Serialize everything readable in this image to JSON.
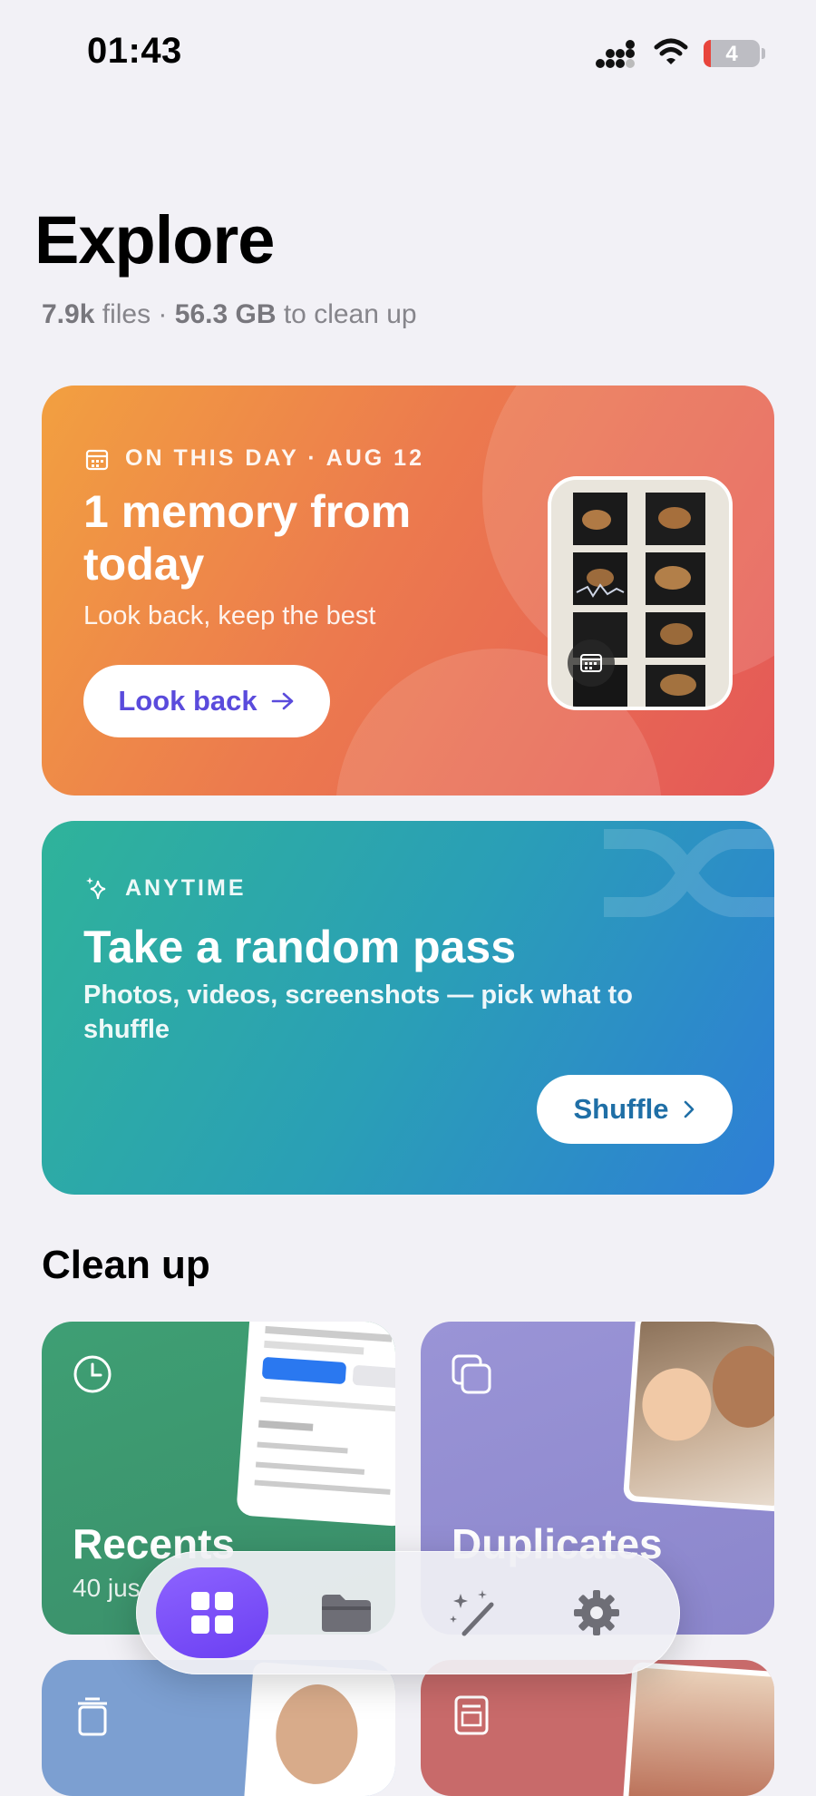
{
  "status_bar": {
    "time": "01:43",
    "battery": "4"
  },
  "header": {
    "title": "Explore",
    "files_count": "7.9k",
    "files_word": "files ·",
    "size": "56.3 GB",
    "size_suffix": "to clean up"
  },
  "memory_card": {
    "eyebrow": "ON THIS DAY · AUG 12",
    "title_line1": "1 memory from",
    "title_line2": "today",
    "subtitle": "Look back, keep the best",
    "button_label": "Look back",
    "button_color": "#5a4bdc",
    "icon": "calendar-icon"
  },
  "random_card": {
    "eyebrow": "ANYTIME",
    "title": "Take a random pass",
    "subtitle_line1": "Photos, videos, screenshots — pick what to",
    "subtitle_line2": "shuffle",
    "button_label": "Shuffle",
    "button_color": "#1f6fa6",
    "icon": "sparkle-icon"
  },
  "clean_up": {
    "title": "Clean up",
    "tiles": [
      {
        "label": "Recents",
        "sub": "40 jus",
        "icon": "clock-icon"
      },
      {
        "label": "Duplicates",
        "icon": "duplicate-icon"
      },
      {
        "icon": "trash-can-icon"
      },
      {
        "icon": "document-image-icon"
      }
    ]
  },
  "tab_bar": {
    "tabs": [
      {
        "icon": "grid-icon",
        "active": true
      },
      {
        "icon": "folder-icon",
        "active": false
      },
      {
        "icon": "magic-wand-icon",
        "active": false
      },
      {
        "icon": "gear-icon",
        "active": false
      }
    ],
    "accent": "#7a4fff"
  }
}
